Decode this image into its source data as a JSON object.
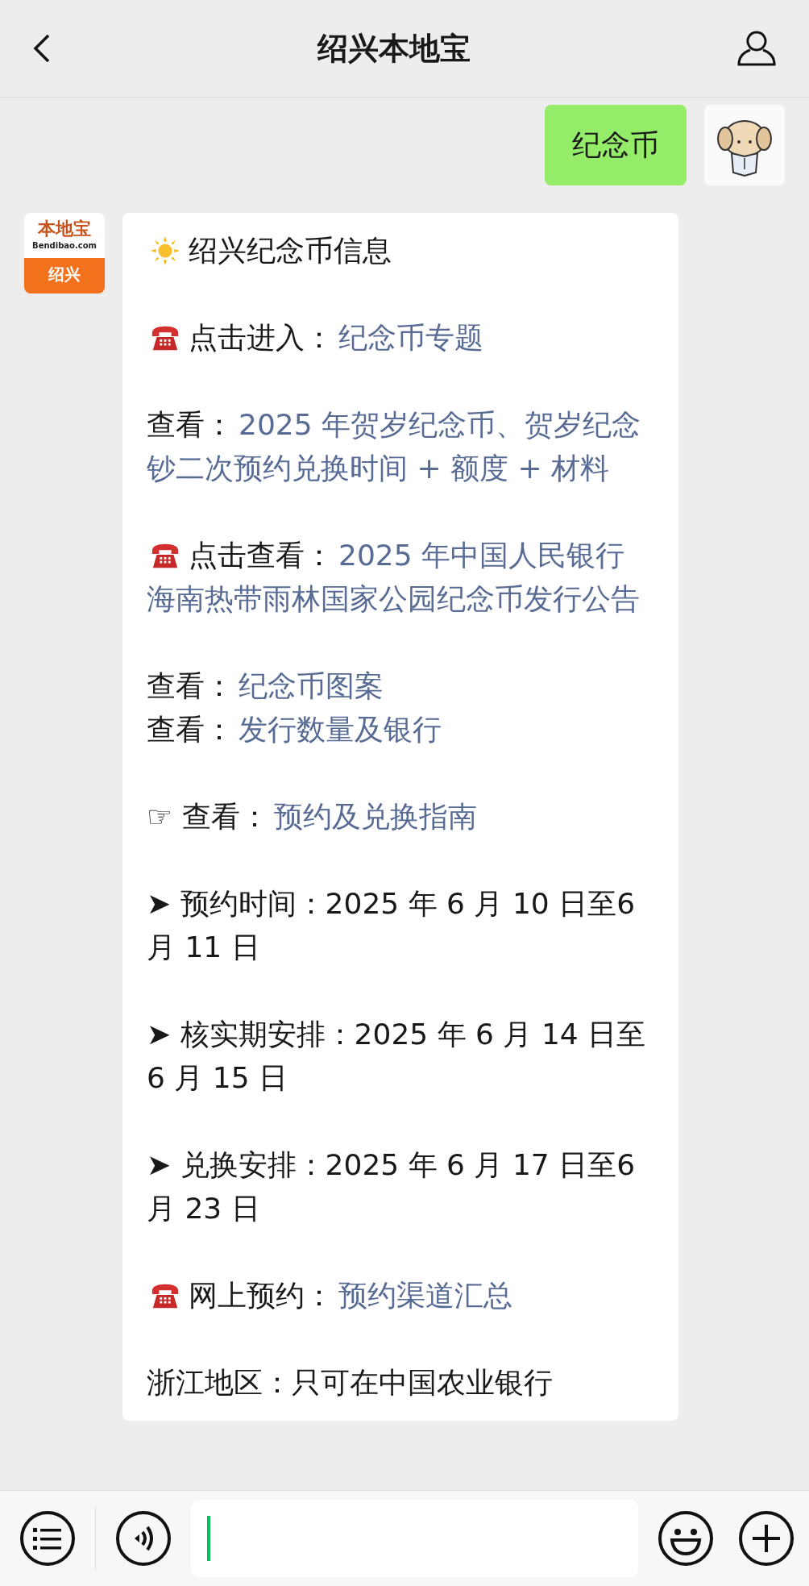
{
  "header": {
    "title": "绍兴本地宝"
  },
  "messages": [
    {
      "kind": "sent",
      "text": "纪念币"
    },
    {
      "kind": "received",
      "avatar": {
        "logo": "本地宝",
        "site": "Bendibao.com",
        "city": "绍兴"
      },
      "paragraphs": [
        {
          "kind": "title",
          "text": "绍兴纪念币信息"
        },
        {
          "kind": "phone",
          "text": "点击进入：",
          "link": "纪念币专题"
        },
        {
          "kind": "link",
          "text": "查看：",
          "link": "2025 年贺岁纪念币、贺岁纪念钞二次预约兑换时间 + 额度 + 材料"
        },
        {
          "kind": "phone",
          "text": "点击查看：",
          "link": "2025 年中国人民银行海南热带雨林国家公园纪念币发行公告"
        },
        {
          "kind": "group",
          "lines": [
            {
              "text": "查看：",
              "link": "纪念币图案"
            },
            {
              "text": "查看：",
              "link": "发行数量及银行"
            }
          ]
        },
        {
          "kind": "link",
          "text": " ☞ 查看：",
          "link": "预约及兑换指南"
        },
        {
          "kind": "plain",
          "text": "➤ 预约时间：2025 年 6 月 10 日至6 月 11 日"
        },
        {
          "kind": "plain",
          "text": "➤ 核实期安排：2025 年 6 月 14 日至 6 月 15 日"
        },
        {
          "kind": "plain",
          "text": "➤ 兑换安排：2025 年 6 月 17 日至6 月 23 日"
        },
        {
          "kind": "phone",
          "text": "网上预约：",
          "link": "预约渠道汇总"
        },
        {
          "kind": "plain",
          "text": "浙江地区：只可在中国农业银行"
        }
      ]
    }
  ]
}
